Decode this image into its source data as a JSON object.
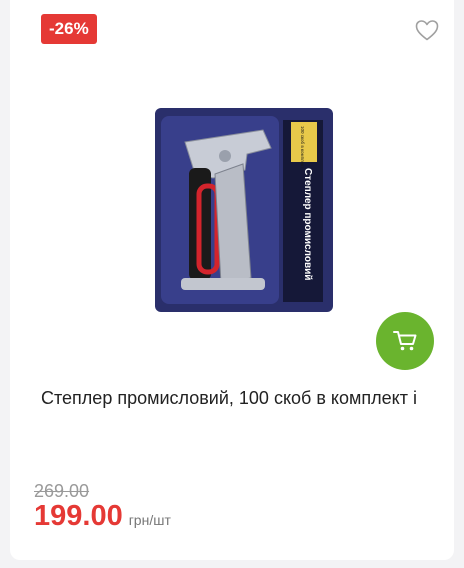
{
  "product": {
    "discount_badge": "-26%",
    "title": "Степлер промисловий, 100 скоб в комплект і",
    "image_text": "Степлер промисловий",
    "image_sticker_text": "100 скоб в комплект",
    "old_price": "269.00",
    "price": "199.00",
    "unit": "грн/шт"
  },
  "icons": {
    "favorite": "heart-icon",
    "cart": "cart-icon"
  },
  "colors": {
    "badge": "#e53935",
    "price": "#e53935",
    "cart_button": "#6ab42e",
    "old_price": "#9a9a9a"
  }
}
